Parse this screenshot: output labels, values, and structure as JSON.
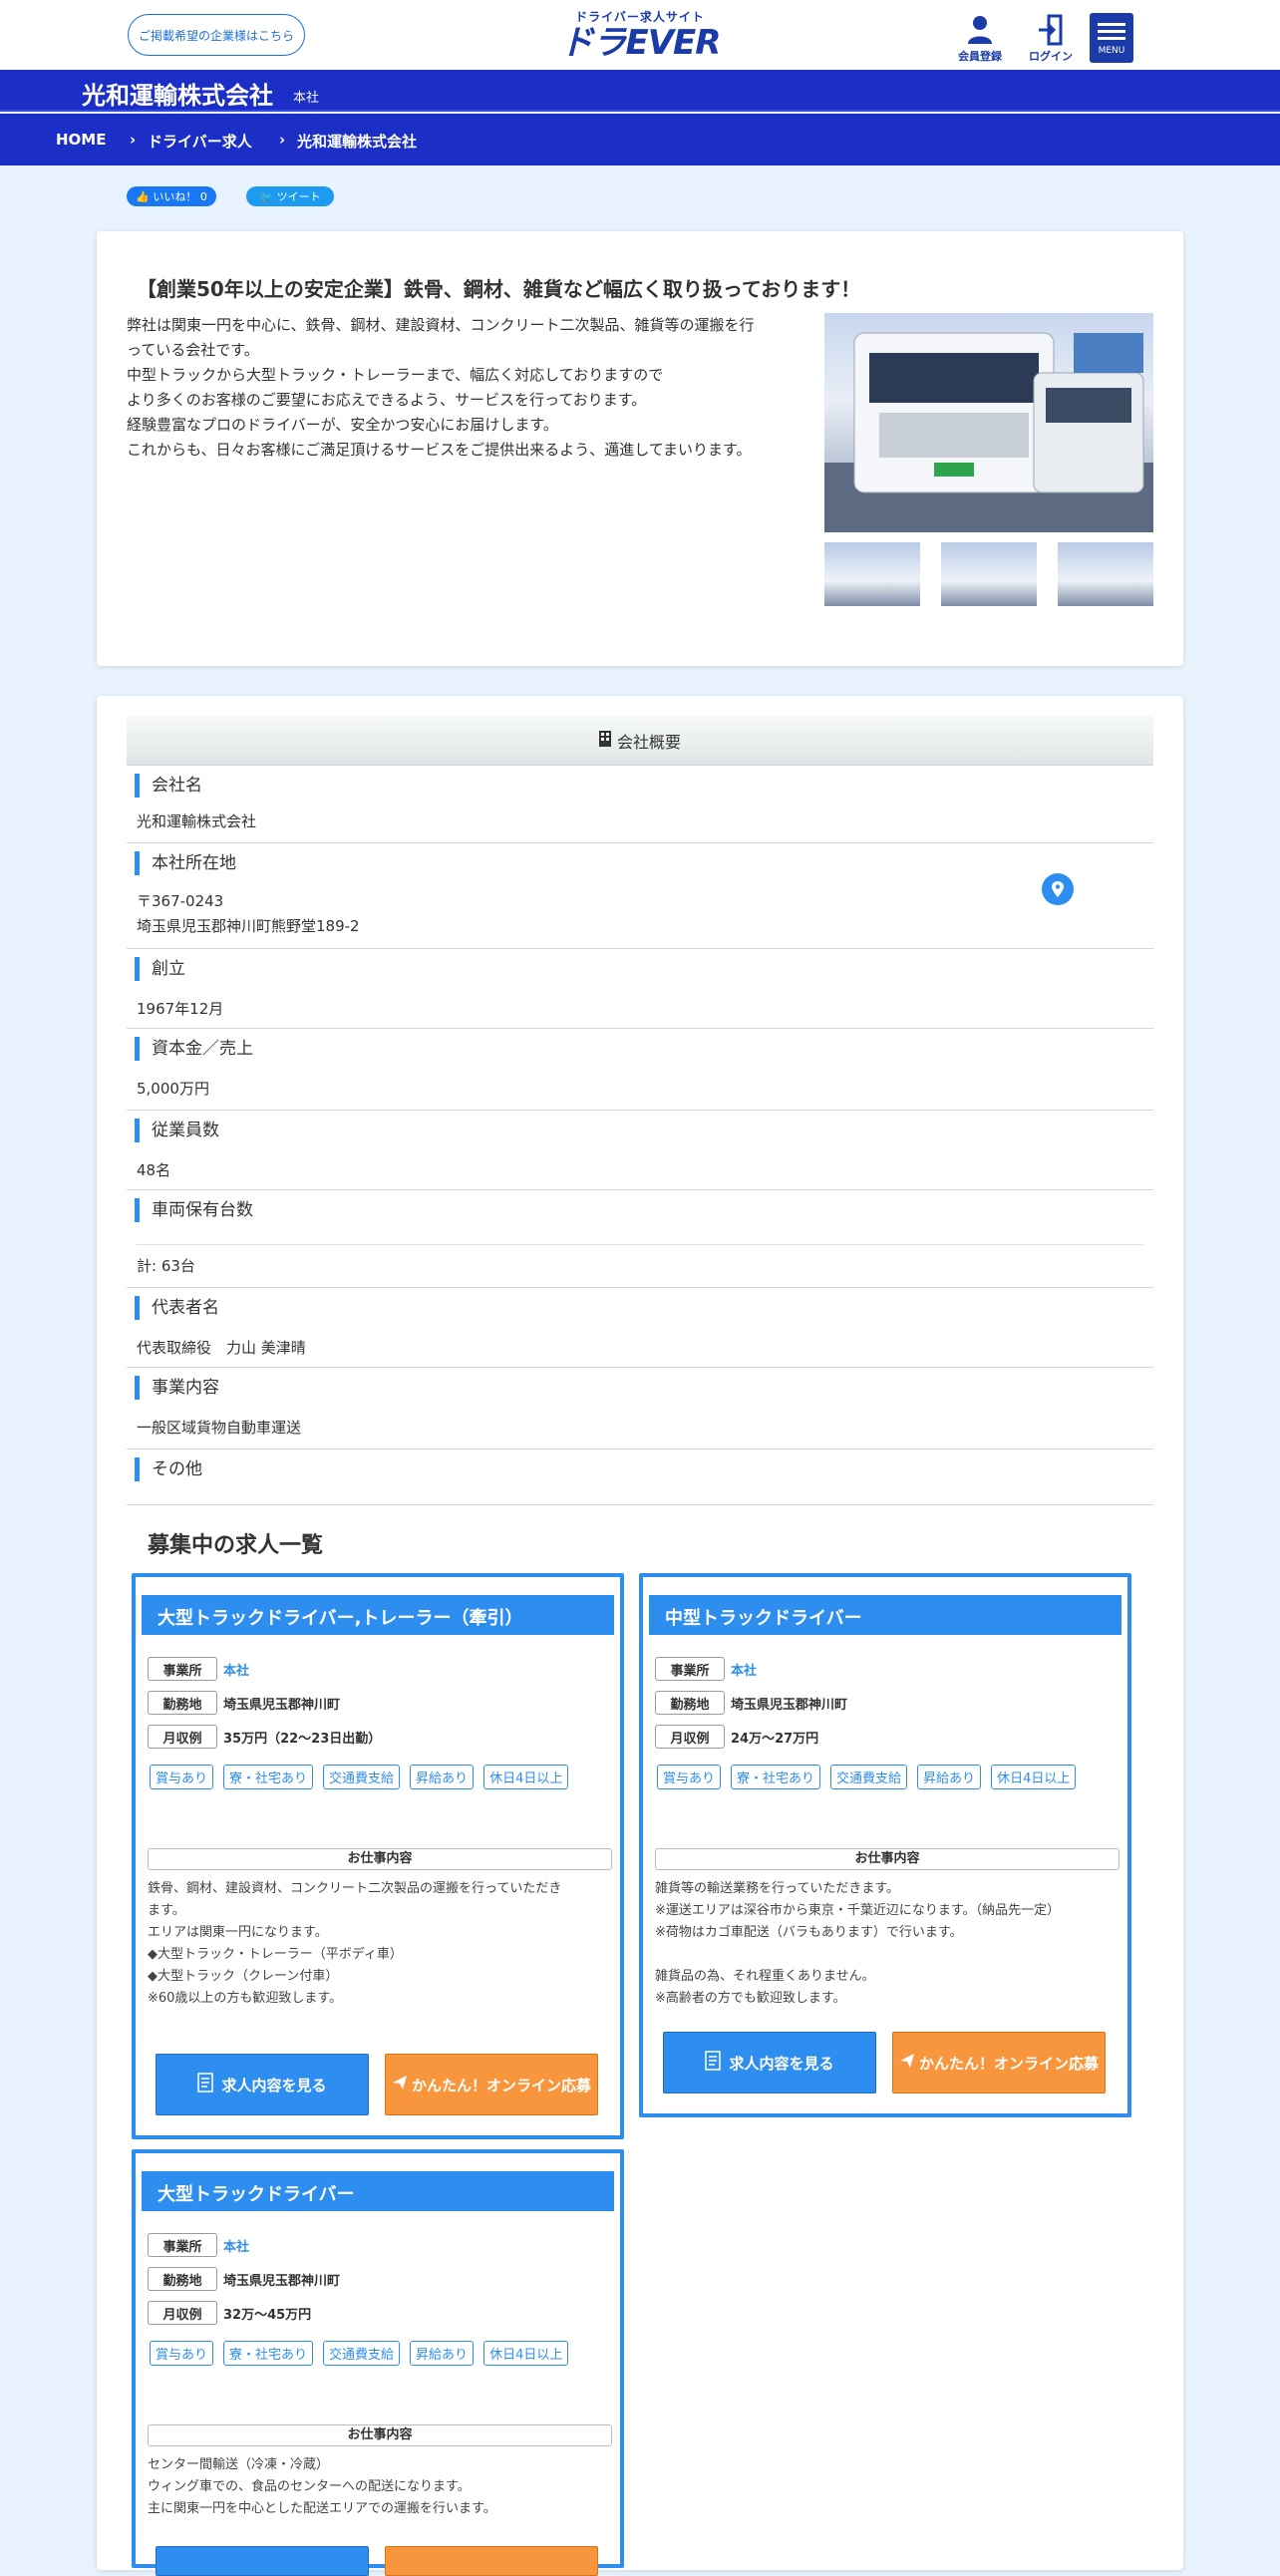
{
  "header": {
    "advertiser_link": "ご掲載希望の企業様はこちら",
    "logo_sub": "ドライバー求人サイト",
    "logo_main": "ドラEVER",
    "register_label": "会員登録",
    "login_label": "ログイン",
    "menu_label": "MENU"
  },
  "company_bar": {
    "name": "光和運輸株式会社",
    "branch": "本社"
  },
  "breadcrumb": [
    "HOME",
    "ドライバー求人",
    "光和運輸株式会社"
  ],
  "social": {
    "like_label": "いいね！",
    "like_count": "0",
    "tweet_label": "ツイート"
  },
  "intro": {
    "title": "【創業50年以上の安定企業】鉄骨、鋼材、雑貨など幅広く取り扱っております！",
    "lines": [
      "弊社は関東一円を中心に、鉄骨、鋼材、建設資材、コンクリート二次製品、雑貨等の運搬を行",
      "っている会社です。",
      "中型トラックから大型トラック・トレーラーまで、幅広く対応しておりますので",
      "より多くのお客様のご要望にお応えできるよう、サービスを行っております。",
      "経験豊富なプロのドライバーが、安全かつ安心にお届けします。",
      "これからも、日々お客様にご満足頂けるサービスをご提供出来るよう、邁進してまいります。"
    ]
  },
  "overview": {
    "heading": "会社概要",
    "rows": [
      {
        "label": "会社名",
        "value": "光和運輸株式会社"
      },
      {
        "label": "本社所在地",
        "value": "〒367-0243",
        "value2": "埼玉県児玉郡神川町熊野堂189-2"
      },
      {
        "label": "創立",
        "value": "1967年12月"
      },
      {
        "label": "資本金／売上",
        "value": "5,000万円"
      },
      {
        "label": "従業員数",
        "value": "48名"
      },
      {
        "label": "車両保有台数",
        "value": "計: 63台"
      },
      {
        "label": "代表者名",
        "value": "代表取締役　力山 美津晴"
      },
      {
        "label": "事業内容",
        "value": "一般区域貨物自動車運送"
      },
      {
        "label": "その他",
        "value": ""
      }
    ]
  },
  "jobs_heading": "募集中の求人一覧",
  "labels": {
    "office": "事業所",
    "location": "勤務地",
    "salary": "月収例",
    "work_content": "お仕事内容",
    "view_button": "求人内容を見る",
    "apply_button": "かんたん！オンライン応募"
  },
  "jobs": [
    {
      "title": "大型トラックドライバー,トレーラー（牽引）",
      "office": "本社",
      "location": "埼玉県児玉郡神川町",
      "salary": "35万円（22～23日出勤）",
      "tags": [
        "賞与あり",
        "寮・社宅あり",
        "交通費支給",
        "昇給あり",
        "休日4日以上"
      ],
      "work_lines": [
        "鉄骨、鋼材、建設資材、コンクリート二次製品の運搬を行っていただき",
        "ます。",
        "エリアは関東一円になります。",
        "◆大型トラック・トレーラー（平ボディ車）",
        "◆大型トラック（クレーン付車）",
        "※60歳以上の方も歓迎致します。"
      ]
    },
    {
      "title": "中型トラックドライバー",
      "office": "本社",
      "location": "埼玉県児玉郡神川町",
      "salary": "24万～27万円",
      "tags": [
        "賞与あり",
        "寮・社宅あり",
        "交通費支給",
        "昇給あり",
        "休日4日以上"
      ],
      "work_lines": [
        "雑貨等の輸送業務を行っていただきます。",
        "※運送エリアは深谷市から東京・千葉近辺になります。（納品先一定）",
        "※荷物はカゴ車配送（バラもあります）で行います。",
        "",
        "雑貨品の為、それ程重くありません。",
        "※高齢者の方でも歓迎致します。"
      ]
    },
    {
      "title": "大型トラックドライバー",
      "office": "本社",
      "location": "埼玉県児玉郡神川町",
      "salary": "32万～45万円",
      "tags": [
        "賞与あり",
        "寮・社宅あり",
        "交通費支給",
        "昇給あり",
        "休日4日以上"
      ],
      "work_lines": [
        "センター間輸送（冷凍・冷蔵）",
        "ウィング車での、食品のセンターへの配送になります。",
        "主に関東一円を中心とした配送エリアでの運搬を行います。"
      ]
    }
  ],
  "colors": {
    "brand_blue": "#1b2fc7",
    "accent_blue": "#2e8ef0",
    "apply_orange": "#f8963d",
    "page_bg": "#e8f3fd"
  }
}
